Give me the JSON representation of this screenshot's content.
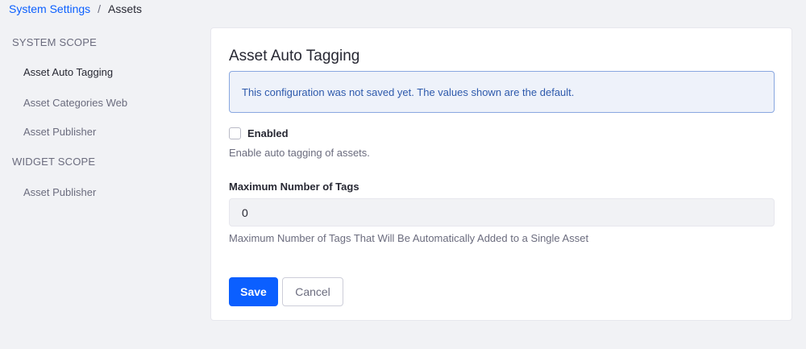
{
  "breadcrumb": {
    "parent": "System Settings",
    "separator": "/",
    "current": "Assets"
  },
  "sidebar": {
    "system_scope_label": "SYSTEM SCOPE",
    "system_items": [
      {
        "label": "Asset Auto Tagging",
        "active": true
      },
      {
        "label": "Asset Categories Web",
        "active": false
      },
      {
        "label": "Asset Publisher",
        "active": false
      }
    ],
    "widget_scope_label": "WIDGET SCOPE",
    "widget_items": [
      {
        "label": "Asset Publisher",
        "active": false
      }
    ]
  },
  "form": {
    "title": "Asset Auto Tagging",
    "alert": "This configuration was not saved yet. The values shown are the default.",
    "enabled": {
      "label": "Enabled",
      "checked": false,
      "help": "Enable auto tagging of assets."
    },
    "max_tags": {
      "label": "Maximum Number of Tags",
      "value": "0",
      "help": "Maximum Number of Tags That Will Be Automatically Added to a Single Asset"
    },
    "save_label": "Save",
    "cancel_label": "Cancel"
  },
  "colors": {
    "primary": "#0b5fff",
    "alert_bg": "#eef2fa",
    "alert_border": "#89a7e0",
    "page_bg": "#f1f2f5"
  }
}
